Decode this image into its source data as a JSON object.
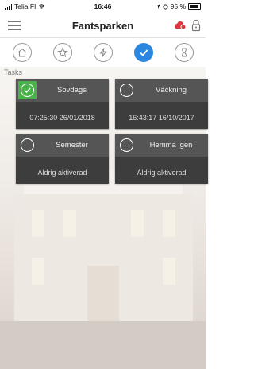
{
  "status_bar": {
    "carrier": "Telia FI",
    "time": "16:46",
    "battery": "95 %"
  },
  "header": {
    "title": "Fantsparken"
  },
  "tabs": [
    {
      "icon": "home-icon",
      "active": false
    },
    {
      "icon": "star-icon",
      "active": false
    },
    {
      "icon": "lightning-icon",
      "active": false
    },
    {
      "icon": "check-icon",
      "active": true
    },
    {
      "icon": "hourglass-icon",
      "active": false
    }
  ],
  "section": {
    "label": "Tasks"
  },
  "tasks": [
    {
      "name": "Sovdags",
      "value": "07:25:30 26/01/2018",
      "enabled": true
    },
    {
      "name": "Väckning",
      "value": "16:43:17 16/10/2017",
      "enabled": false
    },
    {
      "name": "Semester",
      "value": "Aldrig aktiverad",
      "enabled": false
    },
    {
      "name": "Hemma igen",
      "value": "Aldrig aktiverad",
      "enabled": false
    }
  ],
  "colors": {
    "accent": "#2a86df",
    "active_check": "#49b34a",
    "tile": "#3d3d3d"
  }
}
